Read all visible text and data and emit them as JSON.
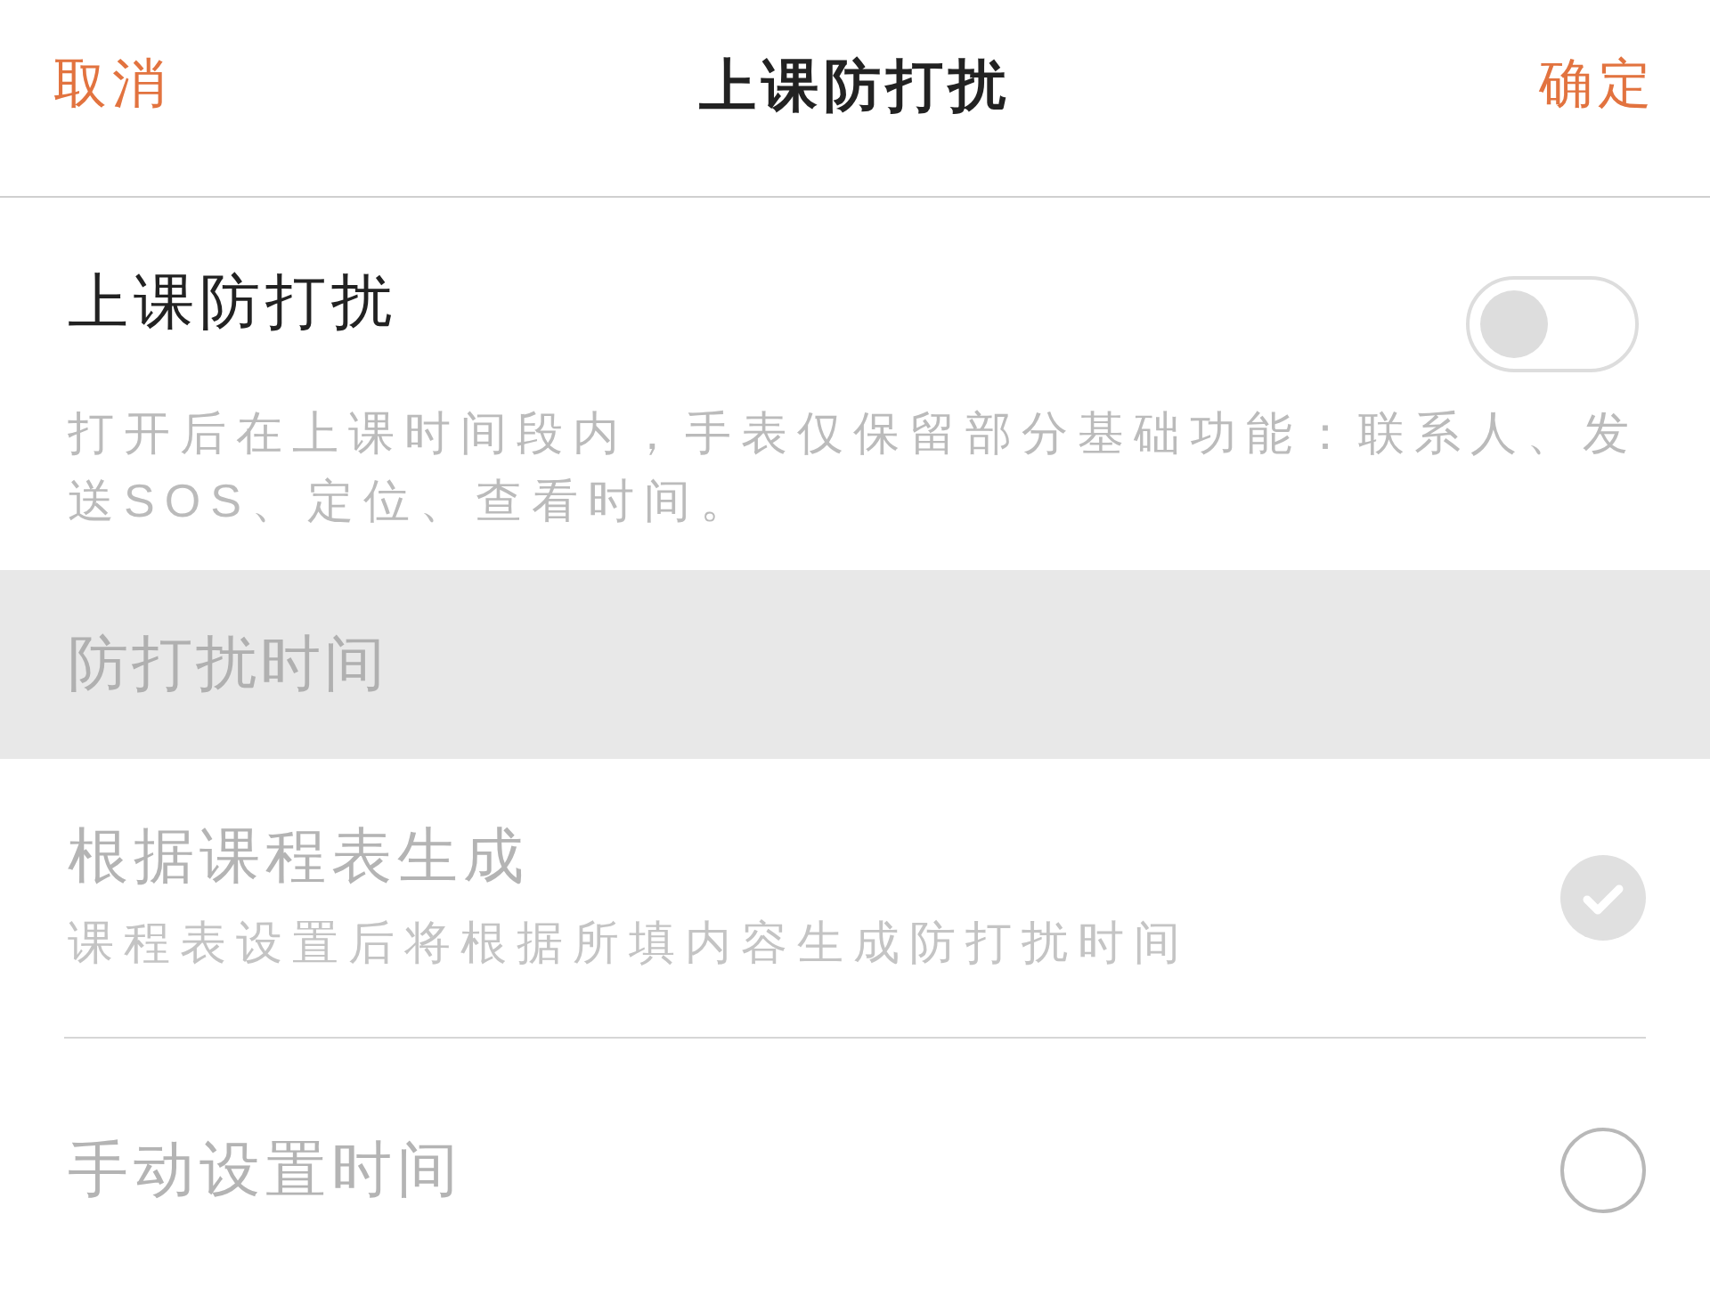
{
  "header": {
    "cancel": "取消",
    "title": "上课防打扰",
    "confirm": "确定"
  },
  "do_not_disturb": {
    "title": "上课防打扰",
    "on": false,
    "description": "打开后在上课时间段内，手表仅保留部分基础功能：联系人、发送SOS、定位、查看时间。"
  },
  "time_section": {
    "heading": "防打扰时间",
    "options": [
      {
        "title": "根据课程表生成",
        "subtitle": "课程表设置后将根据所填内容生成防打扰时间",
        "selected": true,
        "disabled": true
      },
      {
        "title": "手动设置时间",
        "selected": false,
        "disabled": true
      }
    ]
  }
}
